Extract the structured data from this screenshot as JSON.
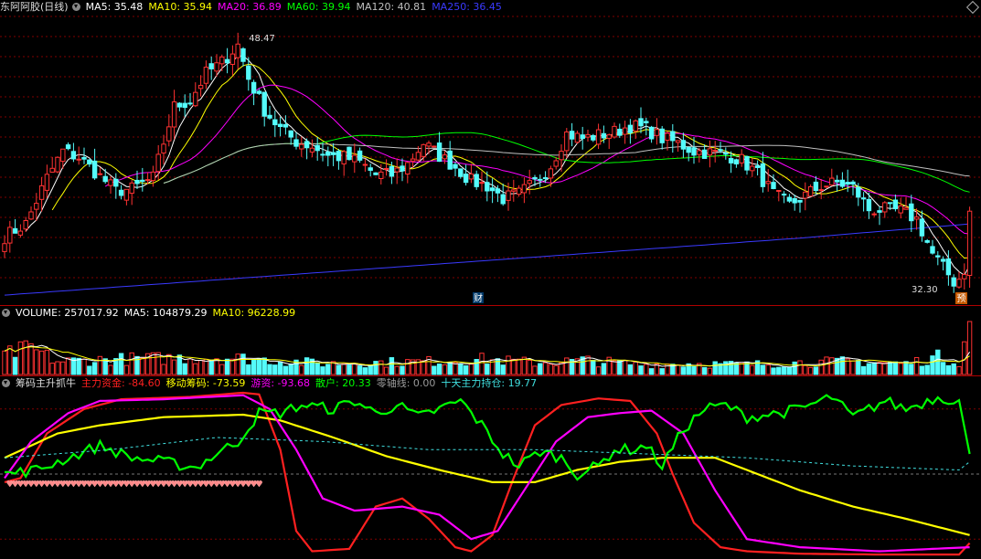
{
  "header": {
    "title": "东阿阿胶(日线)",
    "ma": [
      {
        "label": "MA5: 35.48",
        "color": "#ffffff"
      },
      {
        "label": "MA10: 35.94",
        "color": "#ffff00"
      },
      {
        "label": "MA20: 36.89",
        "color": "#ff00ff"
      },
      {
        "label": "MA60: 39.94",
        "color": "#00ff00"
      },
      {
        "label": "MA120: 40.81",
        "color": "#c0c0c0"
      },
      {
        "label": "MA250: 36.45",
        "color": "#3a3aff"
      }
    ]
  },
  "volume_header": {
    "items": [
      {
        "label": "VOLUME: 257017.92",
        "color": "#ffffff"
      },
      {
        "label": "MA5: 104879.29",
        "color": "#ffffff"
      },
      {
        "label": "MA10: 96228.99",
        "color": "#ffff00"
      }
    ]
  },
  "indicator_header": {
    "name": "筹码主升抓牛",
    "items": [
      {
        "label": "主力资金: -84.60",
        "color": "#ff2020"
      },
      {
        "label": "移动筹码: -73.59",
        "color": "#ffff00"
      },
      {
        "label": "游资: -93.68",
        "color": "#ff00ff"
      },
      {
        "label": "散户: 20.33",
        "color": "#00ff00"
      },
      {
        "label": "零轴线: 0.00",
        "color": "#9a9a9a"
      },
      {
        "label": "十天主力持仓: 19.77",
        "color": "#40e0e0"
      }
    ]
  },
  "annotations": {
    "high_label": "48.47",
    "low_label": "32.30",
    "fin_marker": "财",
    "forecast_marker": "预"
  },
  "colors": {
    "up": "#ff3232",
    "down": "#54fcfc",
    "grid": "#800000",
    "separator": "#b00000"
  },
  "chart_data": {
    "type": "candlestick",
    "price_range": [
      31.5,
      49.5
    ],
    "price_high": 48.47,
    "price_low": 32.3,
    "close_anchors": [
      [
        0,
        35.6
      ],
      [
        4,
        36.4
      ],
      [
        8,
        39.3
      ],
      [
        11,
        41.0
      ],
      [
        14,
        40.6
      ],
      [
        18,
        39.4
      ],
      [
        21,
        38.5
      ],
      [
        24,
        38.6
      ],
      [
        28,
        39.3
      ],
      [
        32,
        43.8
      ],
      [
        35,
        44.2
      ],
      [
        38,
        45.9
      ],
      [
        41,
        46.6
      ],
      [
        44,
        47.7
      ],
      [
        46,
        45.6
      ],
      [
        49,
        43.6
      ],
      [
        52,
        42.4
      ],
      [
        55,
        41.6
      ],
      [
        58,
        41.3
      ],
      [
        61,
        40.7
      ],
      [
        64,
        40.6
      ],
      [
        67,
        40.3
      ],
      [
        70,
        39.5
      ],
      [
        73,
        39.5
      ],
      [
        76,
        40.2
      ],
      [
        79,
        41.5
      ],
      [
        82,
        40.7
      ],
      [
        85,
        40.0
      ],
      [
        88,
        39.1
      ],
      [
        91,
        38.8
      ],
      [
        94,
        38.0
      ],
      [
        97,
        38.3
      ],
      [
        100,
        39.0
      ],
      [
        103,
        40.1
      ],
      [
        106,
        42.1
      ],
      [
        109,
        41.8
      ],
      [
        112,
        42.0
      ],
      [
        115,
        42.2
      ],
      [
        118,
        42.6
      ],
      [
        121,
        42.4
      ],
      [
        124,
        41.8
      ],
      [
        127,
        41.5
      ],
      [
        130,
        41.0
      ],
      [
        133,
        40.9
      ],
      [
        136,
        40.8
      ],
      [
        139,
        40.4
      ],
      [
        142,
        39.6
      ],
      [
        145,
        38.3
      ],
      [
        148,
        37.6
      ],
      [
        151,
        38.2
      ],
      [
        154,
        38.8
      ],
      [
        157,
        39.0
      ],
      [
        160,
        38.7
      ],
      [
        163,
        37.3
      ],
      [
        166,
        37.3
      ],
      [
        169,
        37.2
      ],
      [
        172,
        36.7
      ],
      [
        175,
        34.5
      ],
      [
        178,
        33.2
      ],
      [
        180,
        32.3
      ],
      [
        181,
        33.5
      ],
      [
        182,
        37.2
      ]
    ],
    "volume_max": 257017.92,
    "volume_anchors": [
      [
        0,
        90000
      ],
      [
        5,
        120000
      ],
      [
        10,
        60000
      ],
      [
        20,
        70000
      ],
      [
        30,
        75000
      ],
      [
        40,
        80000
      ],
      [
        48,
        70000
      ],
      [
        60,
        50000
      ],
      [
        70,
        55000
      ],
      [
        80,
        60000
      ],
      [
        90,
        70000
      ],
      [
        100,
        55000
      ],
      [
        110,
        65000
      ],
      [
        120,
        45000
      ],
      [
        130,
        50000
      ],
      [
        140,
        45000
      ],
      [
        150,
        55000
      ],
      [
        160,
        60000
      ],
      [
        170,
        50000
      ],
      [
        176,
        80000
      ],
      [
        180,
        60000
      ],
      [
        182,
        257017.92
      ]
    ],
    "indicator_range": [
      -100,
      100
    ],
    "series": [
      {
        "name": "主力资金",
        "color": "#ff2020",
        "anchors": [
          [
            0,
            -10
          ],
          [
            3,
            -5
          ],
          [
            8,
            50
          ],
          [
            15,
            80
          ],
          [
            22,
            92
          ],
          [
            35,
            95
          ],
          [
            45,
            100
          ],
          [
            48,
            98
          ],
          [
            52,
            30
          ],
          [
            55,
            -70
          ],
          [
            58,
            -95
          ],
          [
            65,
            -92
          ],
          [
            70,
            -40
          ],
          [
            75,
            -30
          ],
          [
            80,
            -55
          ],
          [
            85,
            -90
          ],
          [
            88,
            -95
          ],
          [
            92,
            -75
          ],
          [
            96,
            -5
          ],
          [
            100,
            60
          ],
          [
            105,
            85
          ],
          [
            112,
            93
          ],
          [
            118,
            90
          ],
          [
            123,
            50
          ],
          [
            126,
            0
          ],
          [
            130,
            -60
          ],
          [
            135,
            -90
          ],
          [
            140,
            -95
          ],
          [
            150,
            -98
          ],
          [
            165,
            -99
          ],
          [
            180,
            -99
          ],
          [
            182,
            -85
          ]
        ]
      },
      {
        "name": "移动筹码",
        "color": "#ffff00",
        "anchors": [
          [
            0,
            20
          ],
          [
            5,
            35
          ],
          [
            10,
            50
          ],
          [
            18,
            60
          ],
          [
            30,
            70
          ],
          [
            45,
            73
          ],
          [
            52,
            66
          ],
          [
            62,
            45
          ],
          [
            72,
            22
          ],
          [
            82,
            5
          ],
          [
            92,
            -10
          ],
          [
            100,
            -10
          ],
          [
            108,
            5
          ],
          [
            116,
            15
          ],
          [
            124,
            20
          ],
          [
            134,
            20
          ],
          [
            140,
            5
          ],
          [
            150,
            -20
          ],
          [
            160,
            -40
          ],
          [
            170,
            -55
          ],
          [
            182,
            -75
          ]
        ]
      },
      {
        "name": "游资",
        "color": "#ff00ff",
        "anchors": [
          [
            0,
            -5
          ],
          [
            5,
            40
          ],
          [
            12,
            75
          ],
          [
            18,
            90
          ],
          [
            30,
            92
          ],
          [
            45,
            97
          ],
          [
            50,
            80
          ],
          [
            55,
            30
          ],
          [
            60,
            -30
          ],
          [
            66,
            -45
          ],
          [
            75,
            -40
          ],
          [
            82,
            -50
          ],
          [
            88,
            -80
          ],
          [
            93,
            -70
          ],
          [
            98,
            -20
          ],
          [
            104,
            40
          ],
          [
            110,
            70
          ],
          [
            116,
            75
          ],
          [
            122,
            78
          ],
          [
            128,
            50
          ],
          [
            134,
            -20
          ],
          [
            140,
            -80
          ],
          [
            150,
            -90
          ],
          [
            165,
            -95
          ],
          [
            182,
            -90
          ]
        ]
      },
      {
        "name": "散户",
        "color": "#00ff00",
        "anchors": [
          [
            0,
            0
          ],
          [
            6,
            5
          ],
          [
            12,
            20
          ],
          [
            18,
            35
          ],
          [
            24,
            20
          ],
          [
            30,
            15
          ],
          [
            36,
            8
          ],
          [
            40,
            25
          ],
          [
            44,
            40
          ],
          [
            48,
            75
          ],
          [
            52,
            75
          ],
          [
            56,
            85
          ],
          [
            62,
            80
          ],
          [
            66,
            90
          ],
          [
            70,
            75
          ],
          [
            74,
            85
          ],
          [
            78,
            70
          ],
          [
            82,
            80
          ],
          [
            86,
            90
          ],
          [
            90,
            60
          ],
          [
            94,
            25
          ],
          [
            97,
            10
          ],
          [
            101,
            28
          ],
          [
            105,
            20
          ],
          [
            108,
            0
          ],
          [
            112,
            10
          ],
          [
            115,
            30
          ],
          [
            118,
            30
          ],
          [
            121,
            35
          ],
          [
            124,
            10
          ],
          [
            128,
            55
          ],
          [
            132,
            80
          ],
          [
            136,
            85
          ],
          [
            140,
            70
          ],
          [
            146,
            75
          ],
          [
            150,
            80
          ],
          [
            156,
            95
          ],
          [
            160,
            70
          ],
          [
            166,
            90
          ],
          [
            170,
            80
          ],
          [
            176,
            95
          ],
          [
            180,
            90
          ],
          [
            182,
            20
          ]
        ]
      },
      {
        "name": "十天主力持仓",
        "color": "#40e0e0",
        "dashed": true,
        "anchors": [
          [
            0,
            20
          ],
          [
            20,
            30
          ],
          [
            40,
            45
          ],
          [
            60,
            40
          ],
          [
            80,
            30
          ],
          [
            100,
            30
          ],
          [
            120,
            25
          ],
          [
            140,
            20
          ],
          [
            160,
            10
          ],
          [
            180,
            5
          ],
          [
            182,
            15
          ]
        ]
      }
    ]
  }
}
